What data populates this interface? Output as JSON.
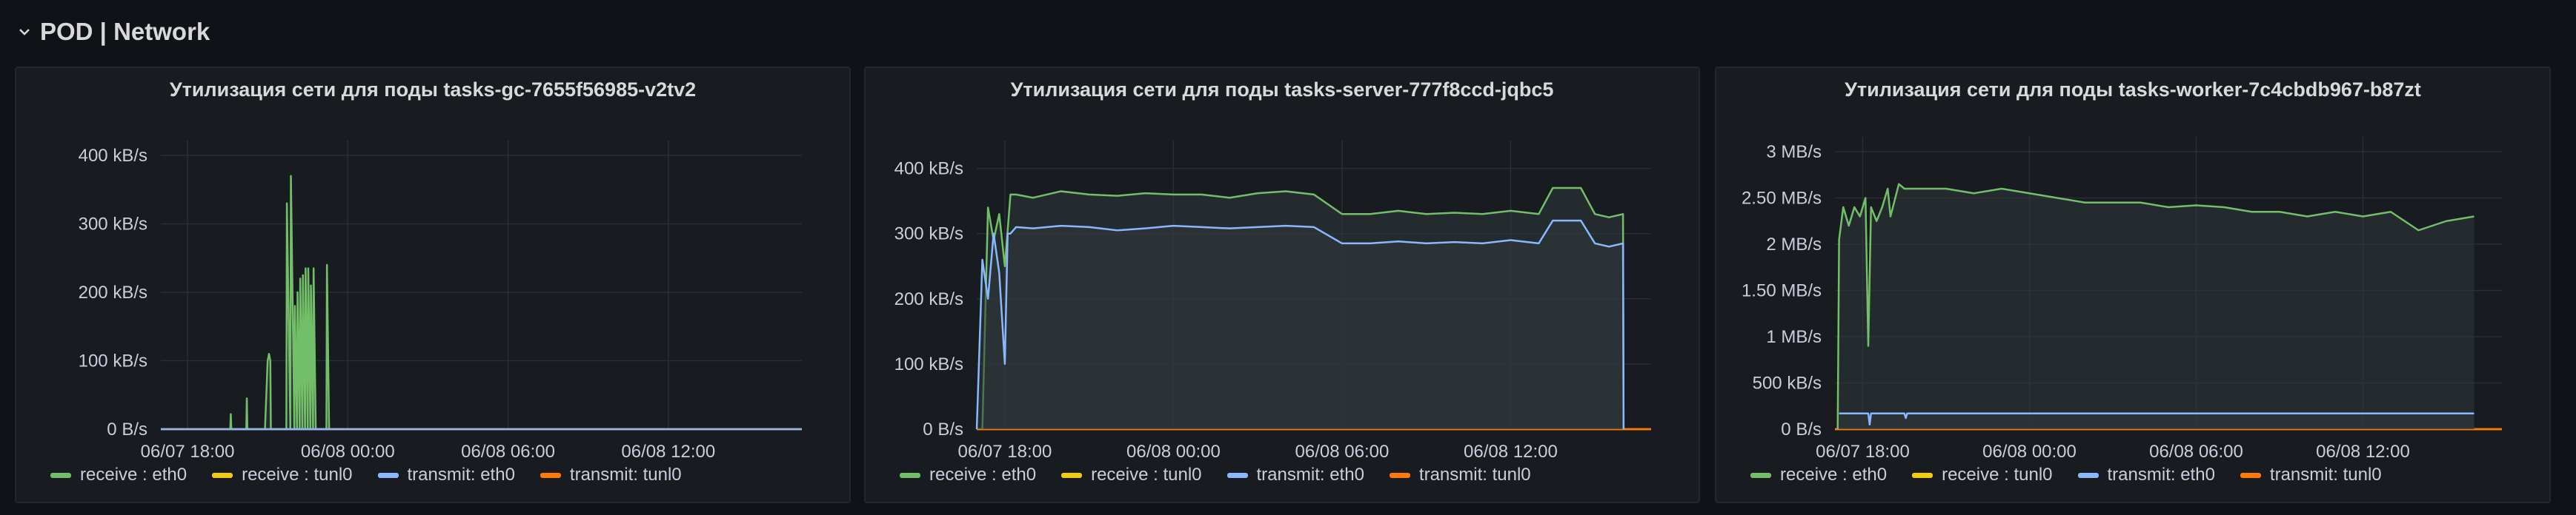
{
  "row": {
    "title": "POD | Network",
    "icon": "chevron-down-icon"
  },
  "legend": [
    "receive : eth0",
    "receive : tunl0",
    "transmit: eth0",
    "transmit: tunl0"
  ],
  "colors": {
    "receive_eth0": "#73bf69",
    "receive_tunl0": "#f2cc0c",
    "transmit_eth0": "#8ab8ff",
    "transmit_tunl0": "#ff780a",
    "grid": "#2a2d33",
    "fill": "#2f393d"
  },
  "chart_data": [
    {
      "type": "line",
      "title": "Утилизация сети для поды tasks-gc-7655f56985-v2tv2",
      "x_ticks": [
        "06/07 18:00",
        "06/08 00:00",
        "06/08 06:00",
        "06/08 12:00"
      ],
      "y_ticks": [
        "0 B/s",
        "100 kB/s",
        "200 kB/s",
        "300 kB/s",
        "400 kB/s"
      ],
      "ylim_kBps": [
        0,
        400
      ],
      "xlim_hours": [
        -1,
        23
      ],
      "series": [
        {
          "name": "receive : eth0",
          "x_hours": [
            1.6,
            1.62,
            1.64,
            2.2,
            2.22,
            2.24,
            2.9,
            3.0,
            3.05,
            3.1,
            3.12,
            3.7,
            3.72,
            3.85,
            3.87,
            4.0,
            4.02,
            4.1,
            4.12,
            4.2,
            4.22,
            4.3,
            4.32,
            4.4,
            4.42,
            4.5,
            4.52,
            4.6,
            4.62,
            4.7,
            4.72,
            4.8,
            4.82,
            5.2,
            5.22,
            5.3
          ],
          "values_kBps": [
            0,
            22,
            0,
            0,
            45,
            0,
            0,
            100,
            110,
            100,
            0,
            0,
            330,
            0,
            370,
            0,
            180,
            0,
            200,
            0,
            220,
            0,
            225,
            0,
            235,
            0,
            235,
            0,
            210,
            0,
            235,
            0,
            0,
            0,
            240,
            0
          ]
        },
        {
          "name": "receive : tunl0",
          "x_hours": [
            -1,
            23
          ],
          "values_kBps": [
            0,
            0
          ]
        },
        {
          "name": "transmit: eth0",
          "x_hours": [
            -1,
            23
          ],
          "values_kBps": [
            0,
            0
          ]
        },
        {
          "name": "transmit: tunl0",
          "x_hours": [
            -1,
            23
          ],
          "values_kBps": [
            0,
            0
          ]
        }
      ]
    },
    {
      "type": "line",
      "title": "Утилизация сети для поды tasks-server-777f8ccd-jqbc5",
      "x_ticks": [
        "06/07 18:00",
        "06/08 00:00",
        "06/08 06:00",
        "06/08 12:00"
      ],
      "y_ticks": [
        "0 B/s",
        "100 kB/s",
        "200 kB/s",
        "300 kB/s",
        "400 kB/s"
      ],
      "ylim_kBps": [
        0,
        420
      ],
      "xlim_hours": [
        -1,
        23
      ],
      "series": [
        {
          "name": "receive : eth0",
          "x_hours": [
            -0.8,
            -0.6,
            -0.4,
            -0.2,
            0.0,
            0.2,
            0.4,
            1.0,
            2.0,
            3.0,
            4.0,
            5.0,
            6.0,
            7.0,
            8.0,
            9.0,
            10.0,
            11.0,
            12.0,
            13.0,
            14.0,
            15.0,
            16.0,
            17.0,
            18.0,
            19.0,
            19.5,
            20.5,
            21.0,
            21.5,
            22.0,
            22.02
          ],
          "values_kBps": [
            0,
            340,
            290,
            330,
            250,
            360,
            360,
            355,
            365,
            360,
            358,
            362,
            360,
            360,
            355,
            362,
            365,
            360,
            330,
            330,
            335,
            330,
            332,
            330,
            335,
            330,
            370,
            370,
            330,
            325,
            330,
            0
          ]
        },
        {
          "name": "transmit: eth0",
          "x_hours": [
            -1.0,
            -0.8,
            -0.6,
            -0.4,
            -0.2,
            0.0,
            0.1,
            0.2,
            0.4,
            1.0,
            2.0,
            3.0,
            4.0,
            5.0,
            6.0,
            7.0,
            8.0,
            9.0,
            10.0,
            11.0,
            12.0,
            13.0,
            14.0,
            15.0,
            16.0,
            17.0,
            18.0,
            19.0,
            19.5,
            20.5,
            21.0,
            21.5,
            22.0,
            22.02
          ],
          "values_kBps": [
            0,
            260,
            200,
            300,
            240,
            100,
            300,
            300,
            310,
            308,
            312,
            310,
            305,
            308,
            312,
            310,
            308,
            310,
            312,
            310,
            285,
            285,
            288,
            285,
            287,
            285,
            290,
            285,
            320,
            320,
            285,
            280,
            285,
            0
          ]
        },
        {
          "name": "receive : tunl0",
          "x_hours": [
            -1,
            23
          ],
          "values_kBps": [
            0,
            0
          ]
        },
        {
          "name": "transmit: tunl0",
          "x_hours": [
            -1,
            23
          ],
          "values_kBps": [
            0,
            0
          ]
        }
      ]
    },
    {
      "type": "line",
      "title": "Утилизация сети для поды tasks-worker-7c4cbdb967-b87zt",
      "x_ticks": [
        "06/07 18:00",
        "06/08 00:00",
        "06/08 06:00",
        "06/08 12:00"
      ],
      "y_ticks": [
        "0 B/s",
        "500 kB/s",
        "1 MB/s",
        "1.50 MB/s",
        "2 MB/s",
        "2.50 MB/s",
        "3 MB/s"
      ],
      "ylim_MBps": [
        0,
        3
      ],
      "xlim_hours": [
        -1,
        23
      ],
      "series": [
        {
          "name": "receive : eth0",
          "x_hours": [
            -0.9,
            -0.85,
            -0.7,
            -0.5,
            -0.3,
            -0.1,
            0.1,
            0.2,
            0.3,
            0.5,
            0.7,
            0.9,
            1.0,
            1.3,
            1.5,
            2.0,
            3.0,
            4.0,
            5.0,
            6.0,
            7.0,
            8.0,
            9.0,
            10.0,
            11.0,
            12.0,
            13.0,
            14.0,
            15.0,
            16.0,
            17.0,
            18.0,
            19.0,
            20.0,
            21.0,
            22.0
          ],
          "values_MBps": [
            0,
            2.05,
            2.4,
            2.2,
            2.4,
            2.3,
            2.5,
            0.9,
            2.4,
            2.25,
            2.4,
            2.6,
            2.3,
            2.65,
            2.6,
            2.6,
            2.6,
            2.55,
            2.6,
            2.55,
            2.5,
            2.45,
            2.45,
            2.45,
            2.4,
            2.42,
            2.4,
            2.35,
            2.35,
            2.3,
            2.35,
            2.3,
            2.35,
            2.15,
            2.25,
            2.3
          ]
        },
        {
          "name": "transmit: eth0",
          "x_hours": [
            -0.85,
            0.2,
            0.25,
            0.3,
            1.5,
            1.55,
            1.6,
            22.0
          ],
          "values_MBps": [
            0.17,
            0.17,
            0.05,
            0.17,
            0.17,
            0.12,
            0.17,
            0.17
          ]
        },
        {
          "name": "receive : tunl0",
          "x_hours": [
            -1,
            23
          ],
          "values_MBps": [
            0,
            0
          ]
        },
        {
          "name": "transmit: tunl0",
          "x_hours": [
            -1,
            23
          ],
          "values_MBps": [
            0,
            0
          ]
        }
      ]
    }
  ]
}
